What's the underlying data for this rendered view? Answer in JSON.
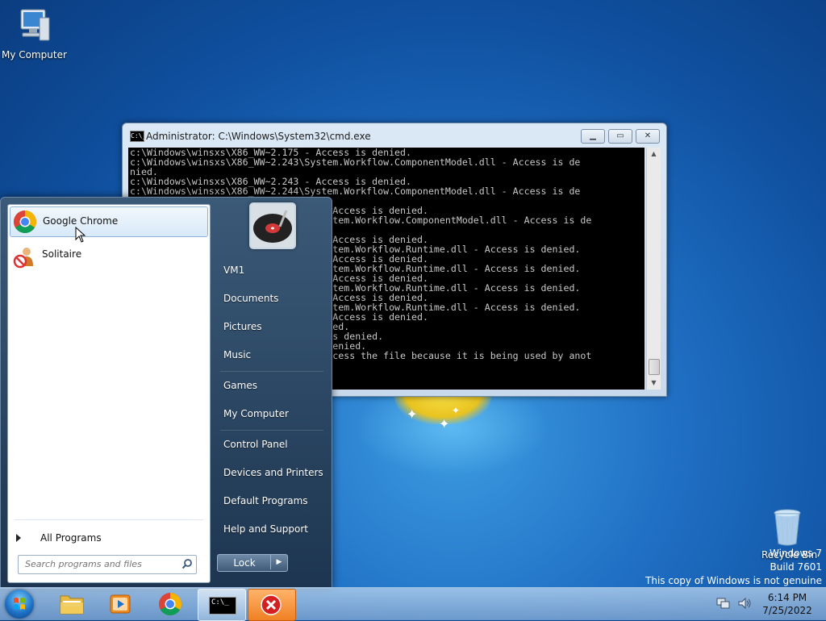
{
  "desktop": {
    "my_computer_label": "My Computer",
    "recycle_bin_label": "Recycle Bin"
  },
  "cmd_window": {
    "title": "Administrator: C:\\Windows\\System32\\cmd.exe",
    "title_icon": "C:\\_",
    "lines": [
      "c:\\Windows\\winsxs\\X86_WW~2.175 - Access is denied.",
      "c:\\Windows\\winsxs\\X86_WW~2.243\\System.Workflow.ComponentModel.dll - Access is de",
      "nied.",
      "c:\\Windows\\winsxs\\X86_WW~2.243 - Access is denied.",
      "c:\\Windows\\winsxs\\X86_WW~2.244\\System.Workflow.ComponentModel.dll - Access is de",
      "nied.",
      "                                  - Access is denied.",
      "                                 System.Workflow.ComponentModel.dll - Access is de",
      "",
      "                                  - Access is denied.",
      "                                 System.Workflow.Runtime.dll - Access is denied.",
      "                                  - Access is denied.",
      "                                 System.Workflow.Runtime.dll - Access is denied.",
      "                                  - Access is denied.",
      "                                 System.Workflow.Runtime.dll - Access is denied.",
      "                                  - Access is denied.",
      "                                 System.Workflow.Runtime.dll - Access is denied.",
      "                                  - Access is denied.",
      "                                 enied.",
      "                                 s is denied.",
      "                                 s denied.",
      "                                  access the file because it is being used by anot"
    ]
  },
  "start_menu": {
    "pinned": [
      {
        "label": "Google Chrome"
      },
      {
        "label": "Solitaire"
      }
    ],
    "all_programs": "All Programs",
    "search_placeholder": "Search programs and files",
    "right_links": [
      "VM1",
      "Documents",
      "Pictures",
      "Music",
      "Games",
      "My Computer",
      "Control Panel",
      "Devices and Printers",
      "Default Programs",
      "Help and Support"
    ],
    "lock_label": "Lock"
  },
  "taskbar": {
    "time": "6:14 PM",
    "date": "7/25/2022",
    "cmd_label": "C:\\_"
  },
  "watermark": {
    "line1": "Windows 7",
    "line2": "Build 7601",
    "line3": "This copy of Windows is not genuine"
  }
}
